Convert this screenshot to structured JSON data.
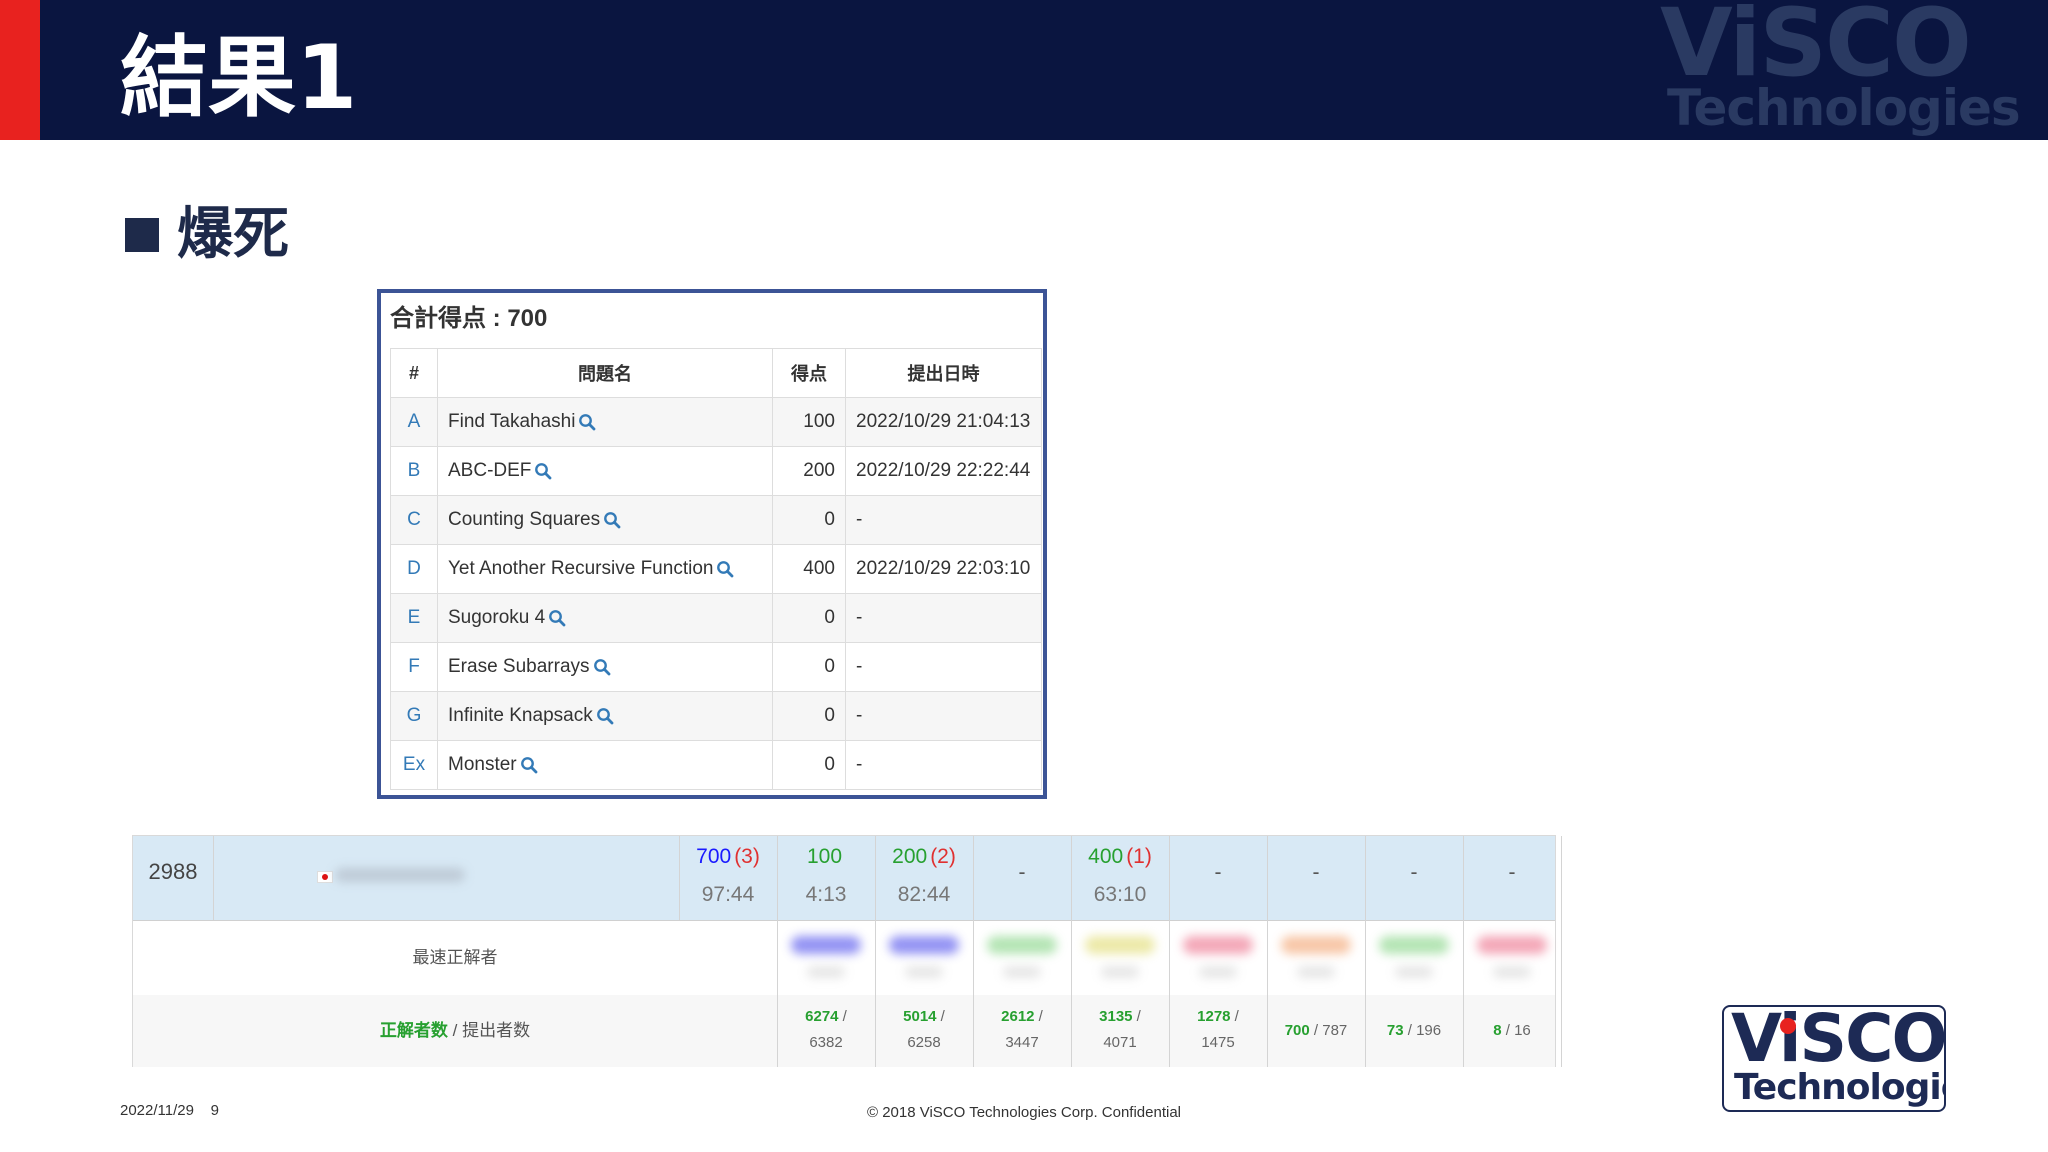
{
  "header": {
    "title": "結果1",
    "watermark": {
      "line1": "ViSCO",
      "line2": "Technologies"
    }
  },
  "section": {
    "heading": "爆死"
  },
  "panel": {
    "total_label": "合計得点 : 700",
    "columns": [
      "#",
      "問題名",
      "得点",
      "提出日時"
    ],
    "rows": [
      {
        "id": "A",
        "name": "Find Takahashi",
        "score": "100",
        "time": "2022/10/29 21:04:13"
      },
      {
        "id": "B",
        "name": "ABC-DEF",
        "score": "200",
        "time": "2022/10/29 22:22:44"
      },
      {
        "id": "C",
        "name": "Counting Squares",
        "score": "0",
        "time": "-"
      },
      {
        "id": "D",
        "name": "Yet Another Recursive Function",
        "score": "400",
        "time": "2022/10/29 22:03:10"
      },
      {
        "id": "E",
        "name": "Sugoroku 4",
        "score": "0",
        "time": "-"
      },
      {
        "id": "F",
        "name": "Erase Subarrays",
        "score": "0",
        "time": "-"
      },
      {
        "id": "G",
        "name": "Infinite Knapsack",
        "score": "0",
        "time": "-"
      },
      {
        "id": "Ex",
        "name": "Monster",
        "score": "0",
        "time": "-"
      }
    ]
  },
  "standings": {
    "rank": "2988",
    "total": {
      "score": "700",
      "penalty": "(3)",
      "time": "97:44"
    },
    "problems": [
      {
        "score": "100",
        "penalty": "",
        "time": "4:13"
      },
      {
        "score": "200",
        "penalty": "(2)",
        "time": "82:44"
      },
      {
        "score": "-",
        "penalty": "",
        "time": ""
      },
      {
        "score": "400",
        "penalty": "(1)",
        "time": "63:10"
      },
      {
        "score": "-",
        "penalty": "",
        "time": ""
      },
      {
        "score": "-",
        "penalty": "",
        "time": ""
      },
      {
        "score": "-",
        "penalty": "",
        "time": ""
      },
      {
        "score": "-",
        "penalty": "",
        "time": ""
      }
    ],
    "fastest_label": "最速正解者",
    "ac_label": "正解者数",
    "sub_label": " / 提出者数",
    "stats": [
      {
        "ac": "6274",
        "sub": "6382"
      },
      {
        "ac": "5014",
        "sub": "6258"
      },
      {
        "ac": "2612",
        "sub": "3447"
      },
      {
        "ac": "3135",
        "sub": "4071"
      },
      {
        "ac": "1278",
        "sub": "1475"
      },
      {
        "ac": "700",
        "sub": "787"
      },
      {
        "ac": "73",
        "sub": "196"
      },
      {
        "ac": "8",
        "sub": "16"
      }
    ],
    "fastest_blur_colors": [
      "#6f6ff0",
      "#6f6ff0",
      "#9bdc9b",
      "#e6e28a",
      "#f08aa0",
      "#f5b48a",
      "#9bdc9b",
      "#f08aa0"
    ]
  },
  "footer": {
    "date": "2022/11/29",
    "page": "9",
    "copyright": "© 2018  ViSCO Technologies Corp.  Confidential"
  },
  "logo": {
    "line1": "ViSCO",
    "line2": "Technologies"
  },
  "colors": {
    "header_bg": "#0a1540",
    "accent_red": "#e8221f",
    "panel_border": "#3c5496",
    "score_blue": "#0000ff",
    "score_green": "#27a030",
    "penalty_red": "#e03030",
    "row_highlight": "#d8e9f5"
  }
}
